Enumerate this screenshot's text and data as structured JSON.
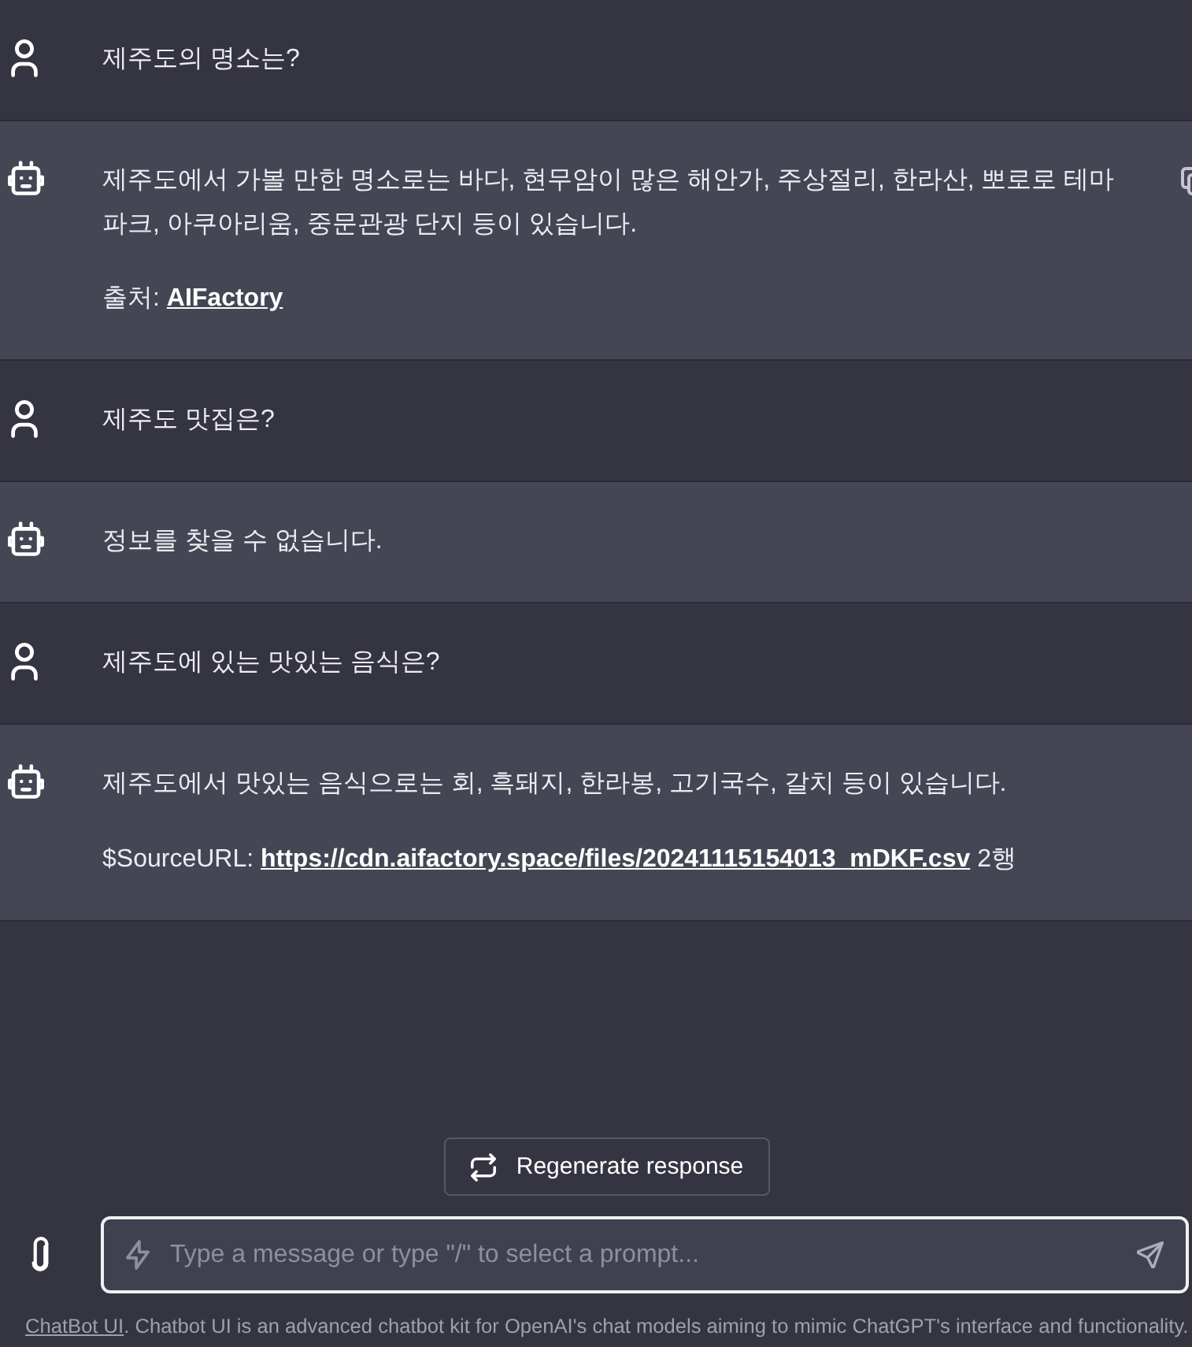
{
  "messages": [
    {
      "kind": "user",
      "copy_visible": false,
      "paragraphs": [
        {
          "spans": [
            {
              "kind": "text",
              "text": "제주도의 명소는?"
            }
          ]
        }
      ]
    },
    {
      "kind": "assistant",
      "copy_visible": true,
      "paragraphs": [
        {
          "spans": [
            {
              "kind": "text",
              "text": "제주도에서 가볼 만한 명소로는 바다, 현무암이 많은 해안가, 주상절리, 한라산, 뽀로로 테마 파크, 아쿠아리움, 중문관광 단지 등이 있습니다."
            }
          ]
        },
        {
          "spans": [
            {
              "kind": "text",
              "text": "출처: "
            },
            {
              "kind": "link",
              "text": "AIFactory"
            }
          ]
        }
      ]
    },
    {
      "kind": "user",
      "copy_visible": false,
      "paragraphs": [
        {
          "spans": [
            {
              "kind": "text",
              "text": "제주도 맛집은?"
            }
          ]
        }
      ]
    },
    {
      "kind": "assistant",
      "copy_visible": false,
      "paragraphs": [
        {
          "spans": [
            {
              "kind": "text",
              "text": "정보를 찾을 수 없습니다."
            }
          ]
        }
      ]
    },
    {
      "kind": "user",
      "copy_visible": false,
      "paragraphs": [
        {
          "spans": [
            {
              "kind": "text",
              "text": "제주도에 있는 맛있는 음식은?"
            }
          ]
        }
      ]
    },
    {
      "kind": "assistant",
      "copy_visible": false,
      "paragraphs": [
        {
          "spans": [
            {
              "kind": "text",
              "text": "제주도에서 맛있는 음식으로는 회, 흑돼지, 한라봉, 고기국수, 갈치 등이 있습니다."
            }
          ]
        },
        {
          "spans": [
            {
              "kind": "text",
              "text": "$SourceURL: "
            },
            {
              "kind": "link",
              "text": "https://cdn.aifactory.space/files/20241115154013_mDKF.csv"
            },
            {
              "kind": "text",
              "text": " 2행"
            }
          ]
        }
      ]
    }
  ],
  "regenerate_button": {
    "label": "Regenerate response"
  },
  "input": {
    "placeholder": "Type a message or type \"/\" to select a prompt...",
    "focused": true
  },
  "footer": {
    "spans": [
      {
        "kind": "link",
        "text": "ChatBot UI"
      },
      {
        "kind": "text",
        "text": ". Chatbot UI is an advanced chatbot kit for OpenAI's chat models aiming to mimic ChatGPT's interface and functionality."
      }
    ]
  }
}
